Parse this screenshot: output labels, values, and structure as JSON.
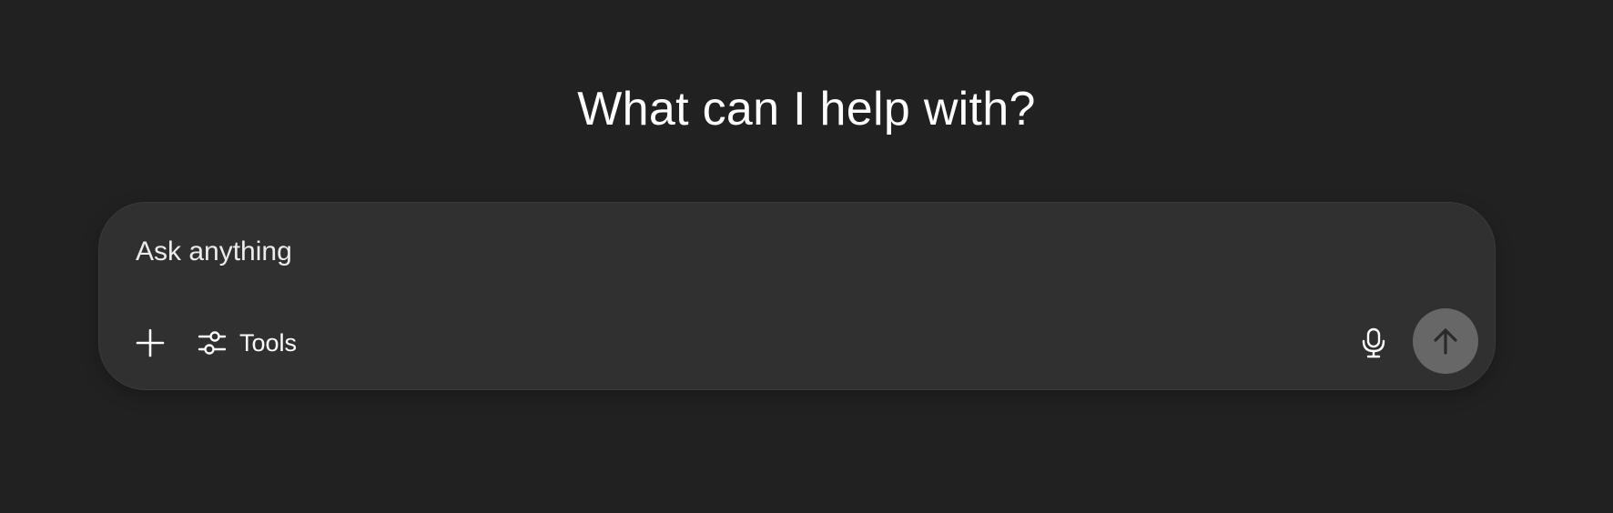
{
  "headline": "What can I help with?",
  "composer": {
    "placeholder": "Ask anything",
    "value": "",
    "tools_label": "Tools"
  },
  "icons": {
    "add": "plus-icon",
    "tools": "sliders-icon",
    "mic": "microphone-icon",
    "send": "arrow-up-icon"
  },
  "colors": {
    "background": "#212121",
    "composer": "#303030",
    "send_button": "#676767",
    "text": "#ffffff"
  }
}
